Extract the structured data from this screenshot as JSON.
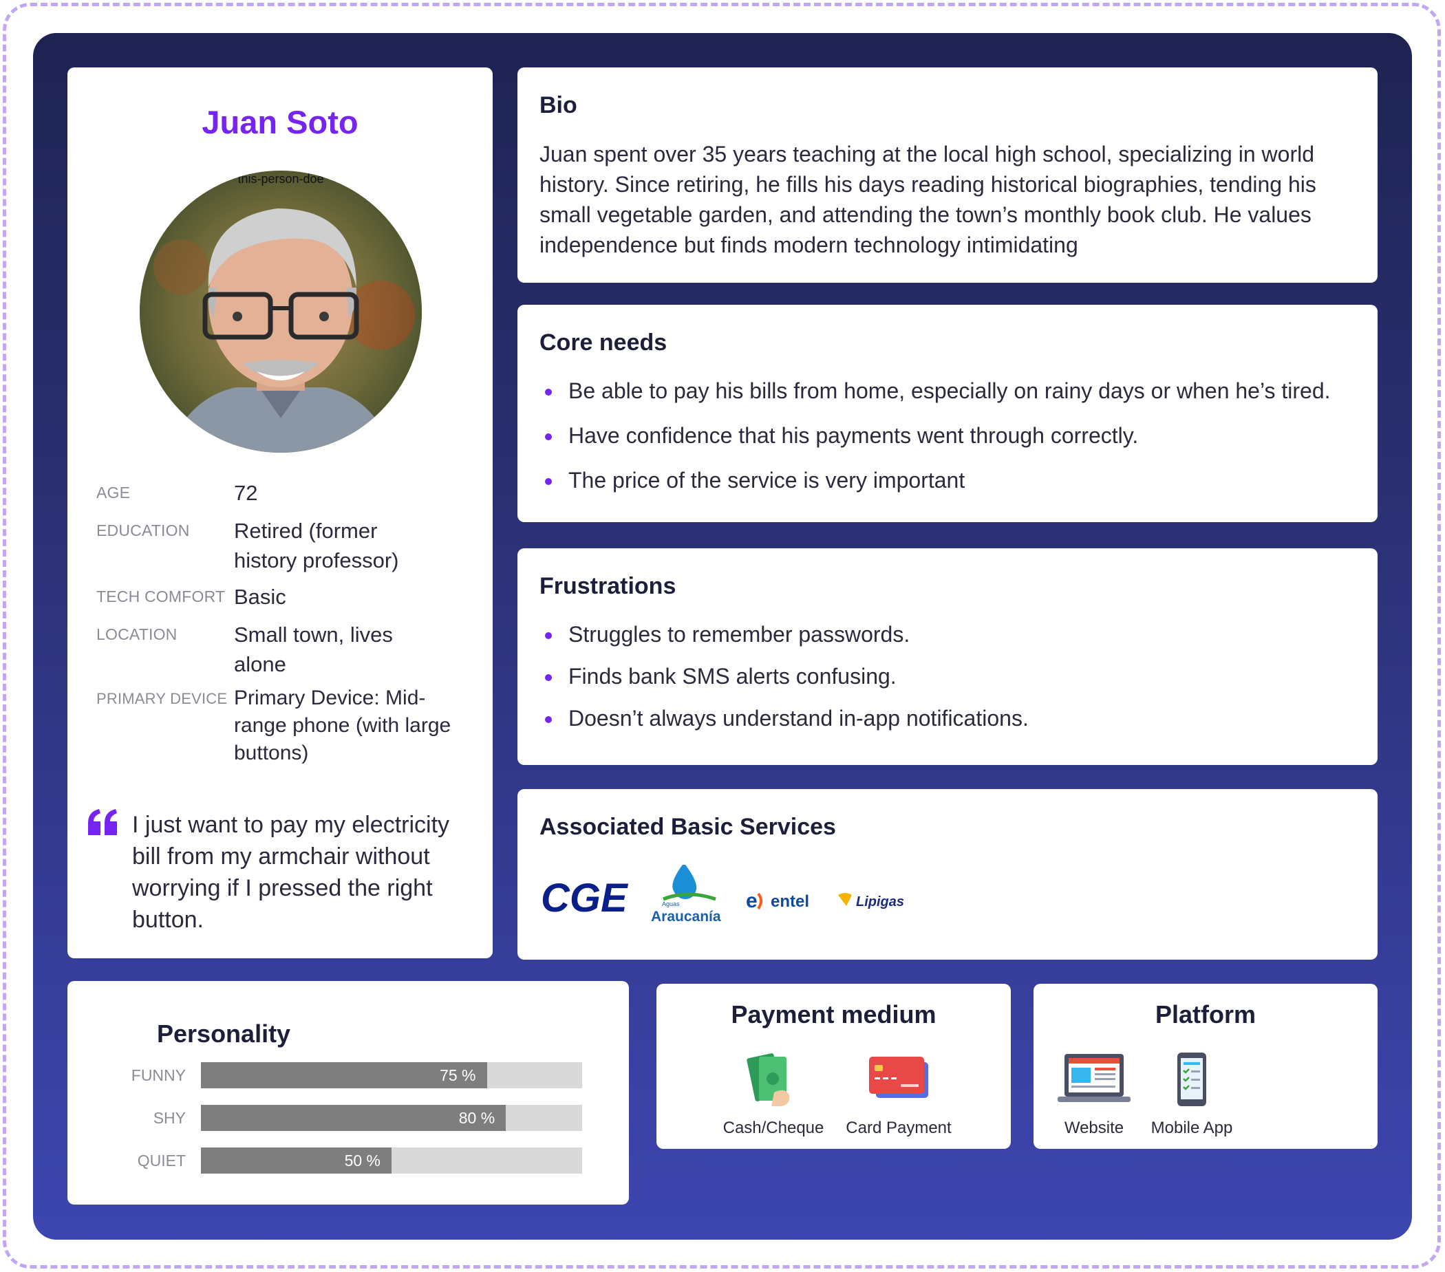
{
  "profile": {
    "name": "Juan Soto",
    "avatar_caption": "this-person-doe",
    "facts": [
      {
        "label": "Age",
        "value": "72"
      },
      {
        "label": "Education",
        "value": "Retired (former history professor)"
      },
      {
        "label": "Tech comfort",
        "value": "Basic"
      },
      {
        "label": "Location",
        "value": "Small town, lives alone"
      },
      {
        "label": "Primary device",
        "value": "Primary Device: Mid-range phone (with large buttons)"
      }
    ],
    "quote": "I just want to pay my electricity bill from my armchair without worrying if I pressed the right button."
  },
  "bio": {
    "title": "Bio",
    "text": "Juan spent over 35 years teaching at the local high school, specializing in world history. Since retiring, he fills his days reading historical biographies, tending his small vegetable garden, and attending the town’s monthly book club. He values independence but finds modern technology intimidating"
  },
  "core_needs": {
    "title": "Core needs",
    "items": [
      "Be able to pay his bills from home, especially on rainy days or when he’s tired.",
      "Have confidence that his payments went through correctly.",
      "The price of the service is very important"
    ]
  },
  "frustrations": {
    "title": "Frustrations",
    "items": [
      "Struggles to remember passwords.",
      "Finds bank SMS alerts confusing.",
      "Doesn’t always understand in-app notifications."
    ]
  },
  "services": {
    "title": "Associated Basic Services",
    "logos": [
      {
        "name": "cge-logo",
        "text": "CGE"
      },
      {
        "name": "aguas-araucania-logo",
        "text": "Araucanía",
        "subtext": "Aguas"
      },
      {
        "name": "entel-logo",
        "text": "entel"
      },
      {
        "name": "lipigas-logo",
        "text": "Lipigas"
      }
    ]
  },
  "personality": {
    "title": "Personality",
    "traits": [
      {
        "label": "Funny",
        "value": 0.75,
        "display": "75 %"
      },
      {
        "label": "Shy",
        "value": 0.8,
        "display": "80 %"
      },
      {
        "label": "Quiet",
        "value": 0.5,
        "display": "50 %"
      }
    ]
  },
  "payment": {
    "title": "Payment medium",
    "options": [
      {
        "label": "Cash/Cheque",
        "icon": "cash-icon"
      },
      {
        "label": "Card Payment",
        "icon": "credit-card-icon"
      }
    ]
  },
  "platform": {
    "title": "Platform",
    "options": [
      {
        "label": "Website",
        "icon": "laptop-icon"
      },
      {
        "label": "Mobile App",
        "icon": "mobile-phone-icon"
      }
    ]
  },
  "colors": {
    "accent": "#7624f0",
    "panel_top": "#1e2352",
    "panel_bottom": "#3d46b0",
    "frame_dash": "#c3a6f3",
    "bar_fill": "#7e7e7e",
    "bar_track": "#d9d9d9"
  }
}
